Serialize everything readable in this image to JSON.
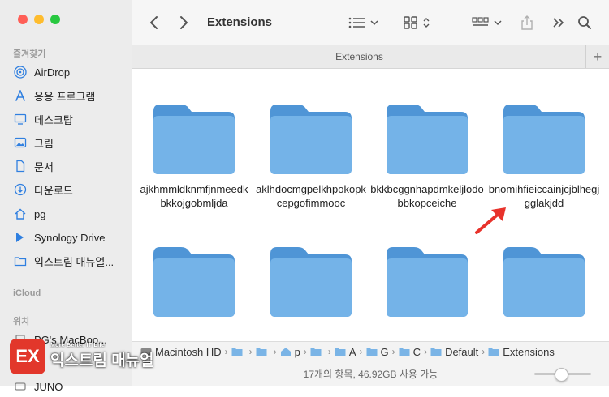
{
  "window": {
    "title": "Extensions"
  },
  "sidebar": {
    "favorites_title": "즐겨찾기",
    "items": [
      {
        "label": "AirDrop",
        "icon": "airdrop-icon"
      },
      {
        "label": "응용 프로그램",
        "icon": "applications-icon"
      },
      {
        "label": "데스크탑",
        "icon": "desktop-icon"
      },
      {
        "label": "그림",
        "icon": "pictures-icon"
      },
      {
        "label": "문서",
        "icon": "document-icon"
      },
      {
        "label": "다운로드",
        "icon": "downloads-icon"
      },
      {
        "label": "pg",
        "icon": "home-icon"
      },
      {
        "label": "Synology Drive",
        "icon": "synology-drive-icon"
      },
      {
        "label": "익스트림 매뉴얼...",
        "icon": "folder-icon"
      }
    ],
    "icloud_title": "iCloud",
    "locations_title": "위치",
    "locations": [
      {
        "label": "PG's MacBoo...",
        "icon": "laptop-icon"
      },
      {
        "label": "JUNO",
        "icon": "drive-icon"
      }
    ]
  },
  "toolbar": {
    "back": "back-icon",
    "forward": "forward-icon",
    "list_view": "list-view-icon",
    "grid_view": "grid-view-icon",
    "group": "group-icon",
    "share": "share-icon",
    "more": "more-icon",
    "search": "search-icon"
  },
  "tab": {
    "label": "Extensions",
    "add": "+"
  },
  "files": [
    {
      "name": "ajkhmmldknmfjnmeedkbkkojgobmljda"
    },
    {
      "name": "aklhdocmgpelkhpokopkcepgofimmooc"
    },
    {
      "name": "bkkbcggnhapdmkeljlodobbkopceiche"
    },
    {
      "name": "bnomihfieiccainjcjblhegjgglakjdd"
    },
    {
      "name": ""
    },
    {
      "name": ""
    },
    {
      "name": ""
    },
    {
      "name": ""
    }
  ],
  "pathbar": {
    "items": [
      {
        "label": "Macintosh HD"
      },
      {
        "label": ""
      },
      {
        "label": ""
      },
      {
        "label": "p"
      },
      {
        "label": ""
      },
      {
        "label": "A"
      },
      {
        "label": "G"
      },
      {
        "label": "C"
      },
      {
        "label": "Default"
      },
      {
        "label": "Extensions"
      }
    ]
  },
  "status": {
    "text": "17개의 항목, 46.92GB 사용 가능",
    "zoom": 0.45
  },
  "watermark": {
    "logo": "EX",
    "tagline": "More Better IT Life",
    "name": "익스트림 매뉴얼"
  },
  "colors": {
    "folder_front": "#74b3e8",
    "folder_back": "#4f95d6",
    "accent_red": "#e2372b"
  }
}
